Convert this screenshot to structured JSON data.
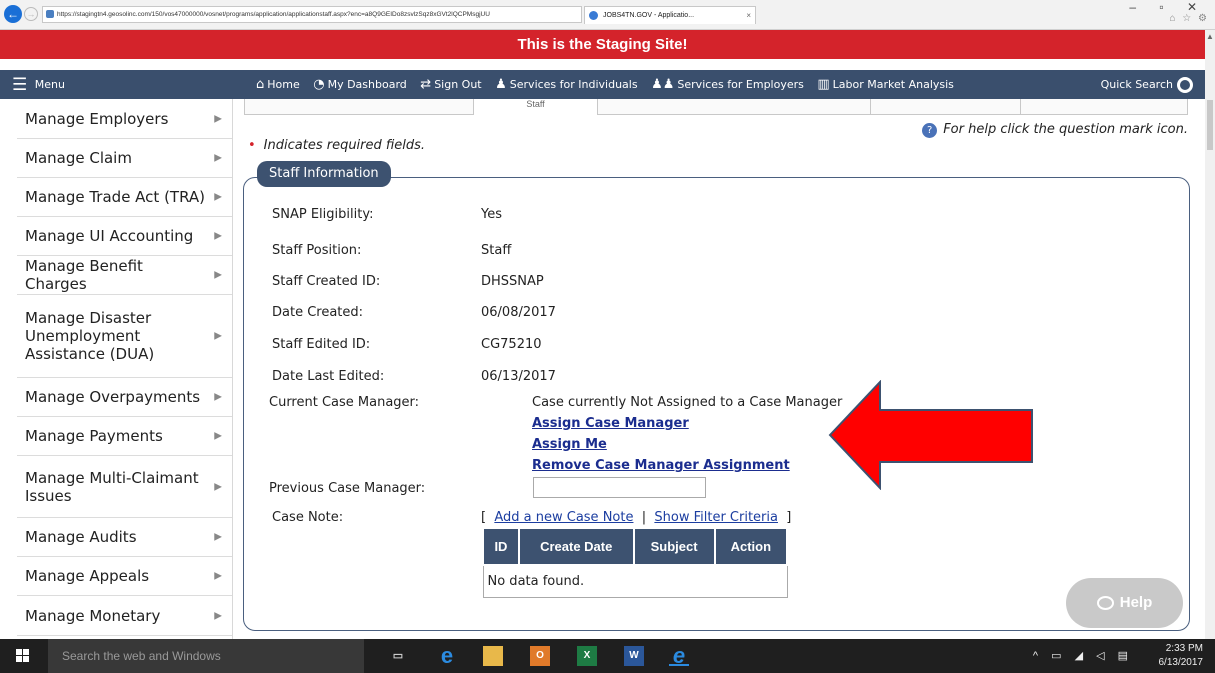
{
  "browser": {
    "url": "https://stagingtn4.geosolinc.com/150/vos47000000/vosnet/programs/application/applicationstaff.aspx?enc=a8Q9GEIDo8zsvlzSqz8xGVt2lQCPMsgjUU",
    "tab_title": "JOBS4TN.GOV - Applicatio...",
    "tab_close": "×",
    "window_controls": "–  ▫  ✕"
  },
  "banner": {
    "text": "This is the Staging Site!"
  },
  "nav": {
    "menu_label": "Menu",
    "links": [
      {
        "label": "Home",
        "icon": "home-icon"
      },
      {
        "label": "My Dashboard",
        "icon": "dashboard-icon"
      },
      {
        "label": "Sign Out",
        "icon": "sign-out-icon"
      },
      {
        "label": "Services for Individuals",
        "icon": "person-icon"
      },
      {
        "label": "Services for Employers",
        "icon": "people-icon"
      },
      {
        "label": "Labor Market Analysis",
        "icon": "chart-icon"
      }
    ],
    "quick_search": "Quick Search"
  },
  "sidebar": {
    "items": [
      {
        "label": "Manage Employers"
      },
      {
        "label": "Manage Claim"
      },
      {
        "label": "Manage Trade Act (TRA)"
      },
      {
        "label": "Manage UI Accounting"
      },
      {
        "label": "Manage Benefit Charges"
      },
      {
        "label": "Manage Disaster Unemployment Assistance (DUA)"
      },
      {
        "label": "Manage Overpayments"
      },
      {
        "label": "Manage Payments"
      },
      {
        "label": "Manage Multi-Claimant Issues"
      },
      {
        "label": "Manage Audits"
      },
      {
        "label": "Manage Appeals"
      },
      {
        "label": "Manage Monetary"
      }
    ]
  },
  "main": {
    "tab_fragment": "Staff",
    "required_note": "Indicates required fields.",
    "required_star": "•",
    "help_note": "For help click the question mark icon.",
    "section_title": "Staff Information",
    "fields": [
      {
        "label": "SNAP Eligibility:",
        "value": "Yes"
      },
      {
        "label": "Staff Position:",
        "value": "Staff"
      },
      {
        "label": "Staff Created ID:",
        "value": "DHSSNAP"
      },
      {
        "label": "Date Created:",
        "value": "06/08/2017"
      },
      {
        "label": "Staff Edited ID:",
        "value": "CG75210"
      },
      {
        "label": "Date Last Edited:",
        "value": "06/13/2017"
      }
    ],
    "case_manager": {
      "label": "Current Case Manager:",
      "status": "Case currently Not Assigned to a Case Manager",
      "assign_link": "Assign Case Manager",
      "assign_me_link": "Assign Me",
      "remove_link": "Remove Case Manager Assignment"
    },
    "previous_case_manager": {
      "label": "Previous Case Manager:",
      "value": ""
    },
    "case_note": {
      "label": "Case Note:",
      "open_bracket": "[",
      "add_link": "Add a new Case Note",
      "divider": "|",
      "filter_link": "Show Filter Criteria",
      "close_bracket": "]",
      "columns": [
        "ID",
        "Create Date",
        "Subject",
        "Action"
      ],
      "empty_text": "No data found."
    },
    "help_button": "Help"
  },
  "taskbar": {
    "search_placeholder": "Search the web and Windows",
    "time": "2:33 PM",
    "date": "6/13/2017"
  },
  "colors": {
    "banner": "#d4232b",
    "nav": "#3a4f6d",
    "section_header": "#3d5270",
    "link": "#1b2d8f",
    "arrow": "#ff0000"
  }
}
